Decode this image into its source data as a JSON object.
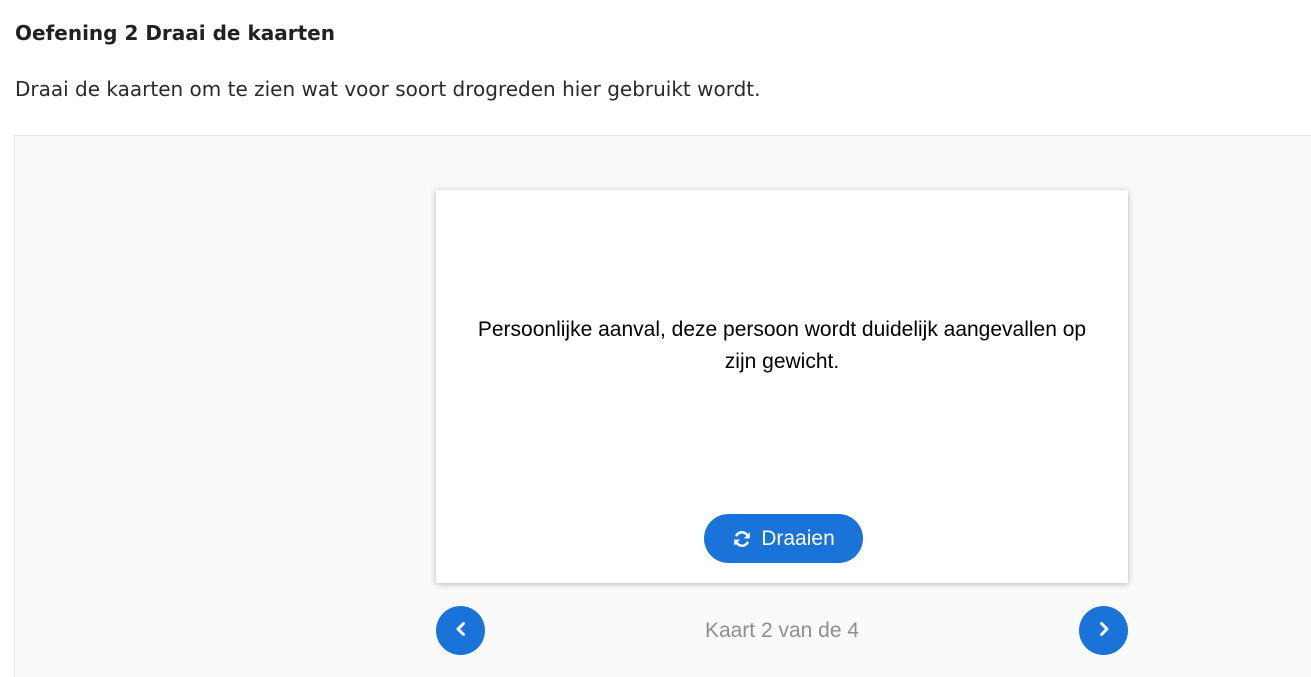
{
  "exercise": {
    "title": "Oefening 2 Draai de kaarten",
    "instruction": "Draai de kaarten om te zien wat voor soort drogreden hier gebruikt wordt."
  },
  "card": {
    "text": "Persoonlijke aanval, deze persoon wordt duidelijk aangevallen op zijn gewicht.",
    "flip_label": "Draaien",
    "flip_icon": "rotate-icon"
  },
  "navigation": {
    "counter": "Kaart 2 van de 4",
    "current": 2,
    "total": 4,
    "prev_icon": "chevron-left-icon",
    "next_icon": "chevron-right-icon"
  },
  "colors": {
    "accent": "#1a73d9",
    "counter_text": "#8f8f8f",
    "panel_bg": "#fafafa"
  }
}
